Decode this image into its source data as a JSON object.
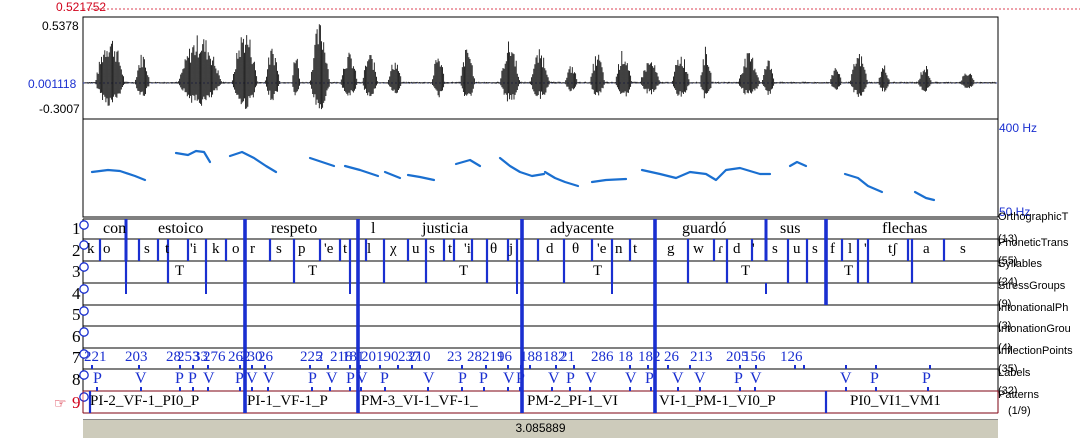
{
  "waveform": {
    "max_value": "0.521752",
    "top_value": "0.5378",
    "cursor_value": "0.001118",
    "bottom_value": "-0.3007"
  },
  "pitch": {
    "top_label": "400 Hz",
    "bottom_label": "50 Hz"
  },
  "tiers": [
    {
      "num": "1",
      "name": "OrthographicT",
      "count": "(13)"
    },
    {
      "num": "2",
      "name": "PhoneticTrans",
      "count": "(55)"
    },
    {
      "num": "3",
      "name": "Syllables",
      "count": "(24)"
    },
    {
      "num": "4",
      "name": "StressGroups",
      "count": "(9)"
    },
    {
      "num": "5",
      "name": "IntonationalPh",
      "count": "(3)"
    },
    {
      "num": "6",
      "name": "IntonationGrou",
      "count": "(4)"
    },
    {
      "num": "7",
      "name": "InflectionPoints",
      "count": "(35)"
    },
    {
      "num": "8",
      "name": "Labels",
      "count": "(32)"
    },
    {
      "num": "9",
      "name": "Patterns",
      "count": "(1/9)"
    }
  ],
  "words": [
    "con",
    "estoico",
    "respeto",
    "l",
    "justicia",
    "adyacente",
    "guardó",
    "sus",
    "flechas"
  ],
  "phones": [
    "k",
    "o",
    "s",
    "t",
    "'i",
    "k",
    "o",
    "r",
    "s",
    "p",
    "'e",
    "t",
    "l",
    "χ",
    "u",
    "s",
    "t",
    "'i",
    "θ",
    "j",
    "d",
    "θ",
    "'e",
    "n",
    "t",
    "g",
    "w",
    "ɾ",
    "d",
    "'",
    "s",
    "u",
    "s",
    "f",
    "l",
    "'",
    "tʃ",
    "a",
    "s"
  ],
  "syllable_marks": [
    "T",
    "T",
    "T",
    "T",
    "T",
    "T"
  ],
  "inflection_values": [
    "221",
    "203",
    "28",
    "253",
    "33",
    "276",
    "262",
    "230",
    "26",
    "225",
    "2",
    "218",
    "181",
    "20",
    "190",
    "237",
    "210",
    "23",
    "28",
    "219",
    "16",
    "188",
    "182",
    "21",
    "286",
    "18",
    "182",
    "26",
    "213",
    "205",
    "156",
    "126"
  ],
  "label_values": [
    "P",
    "V",
    "P",
    "P",
    "V",
    "P",
    "V",
    "V",
    "P",
    "V",
    "P",
    "V",
    "P",
    "V",
    "P",
    "P",
    "V",
    "P",
    "V",
    "P",
    "V",
    "V",
    "P",
    "V",
    "V",
    "P",
    "V",
    "V",
    "P",
    "P",
    "V",
    "V"
  ],
  "patterns": [
    "PI-2_VF-1_PI0_P",
    "PI-1_VF-1_P",
    "PM-3_VI-1_VF-1_",
    "PM-2_PI-1_VI",
    "VI-1_PM-1_VI0_P",
    "PI0_VI1_VM1"
  ],
  "time_value": "3.085889",
  "colors": {
    "boundary": "#1a2fd0",
    "pitch": "#1a6fd0",
    "selected": "#d0021b"
  }
}
